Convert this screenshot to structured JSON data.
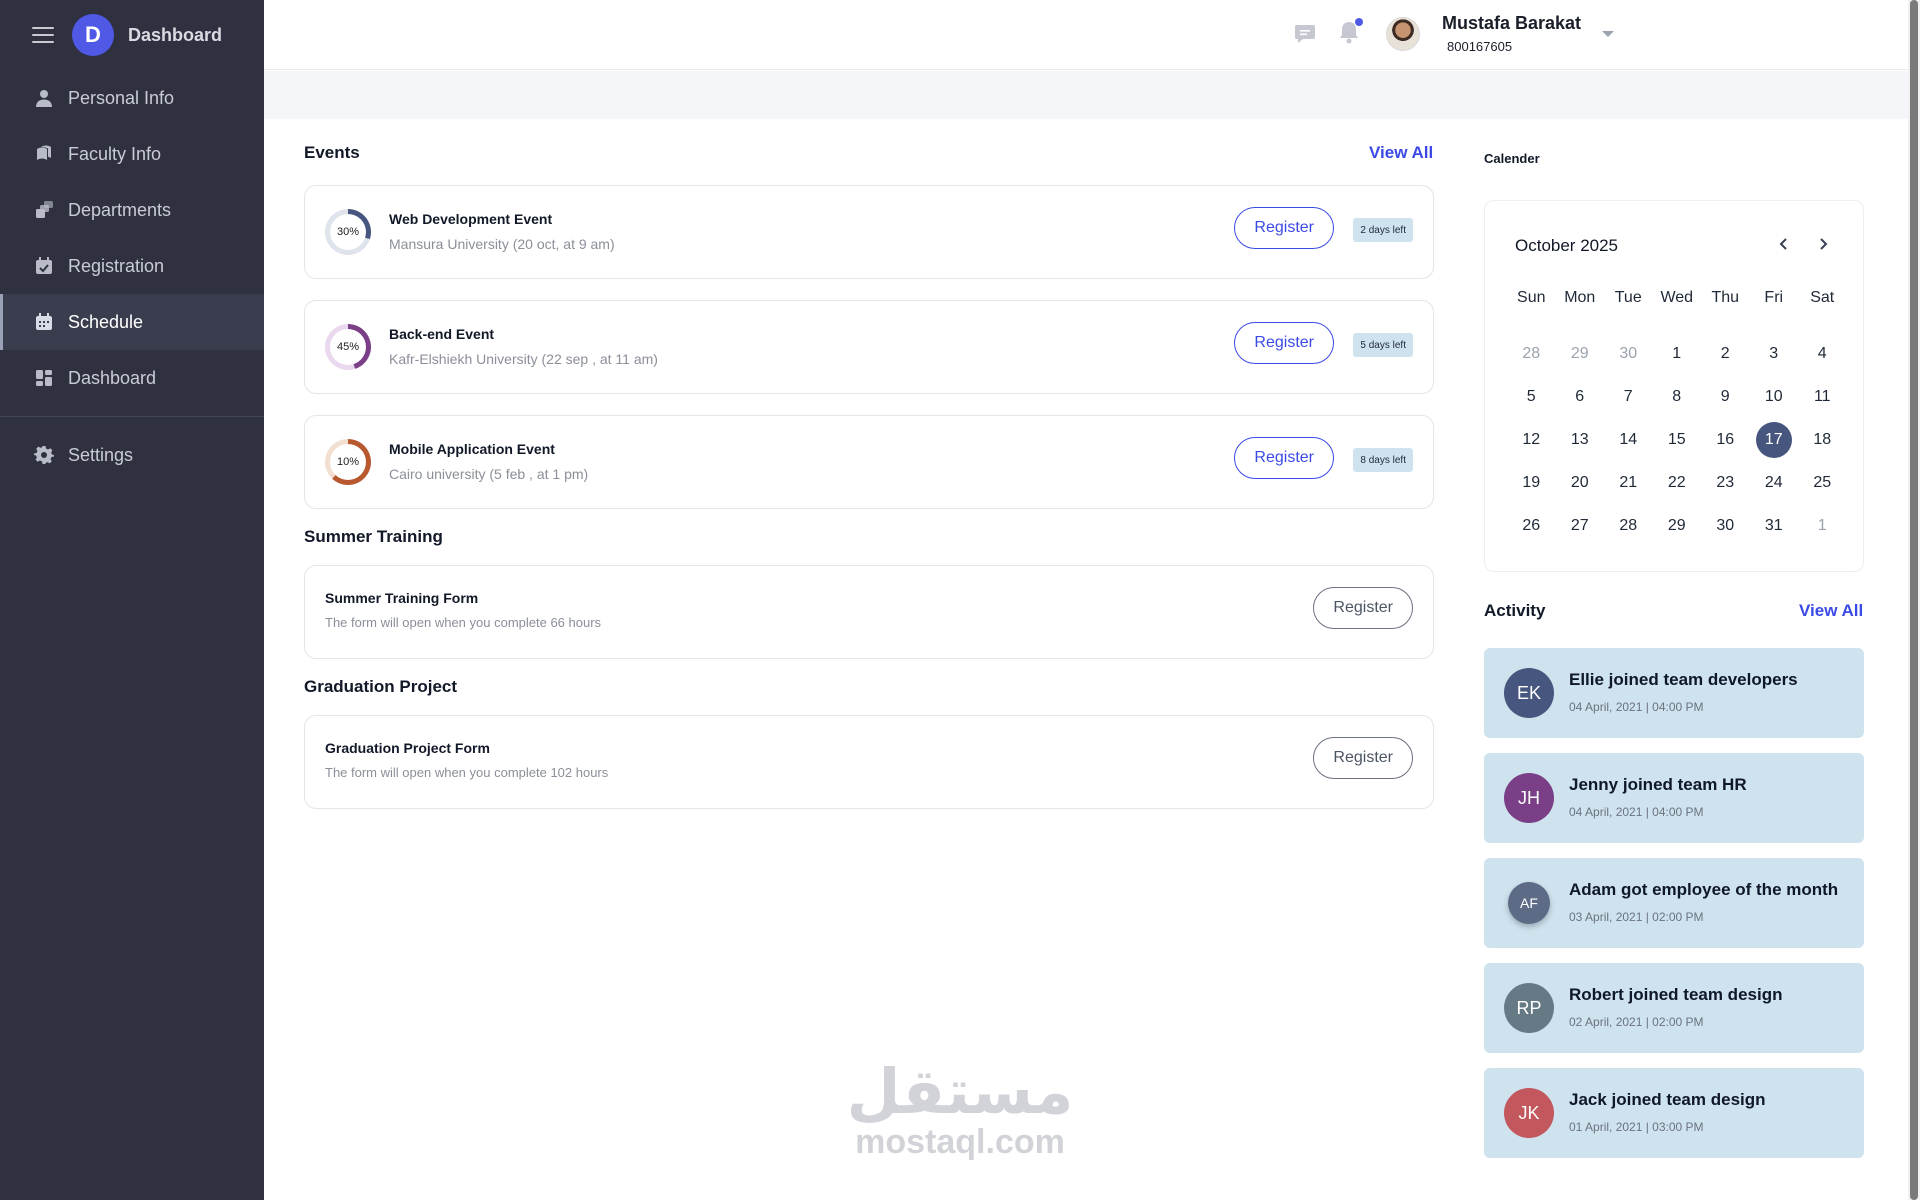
{
  "sidebar": {
    "brand": "Dashboard",
    "logo_letter": "D",
    "items": [
      {
        "label": "Personal Info",
        "icon": "person-icon"
      },
      {
        "label": "Faculty Info",
        "icon": "faculty-icon"
      },
      {
        "label": "Departments",
        "icon": "departments-icon"
      },
      {
        "label": "Registration",
        "icon": "registration-icon"
      },
      {
        "label": "Schedule",
        "icon": "calendar-icon",
        "active": true
      },
      {
        "label": "Dashboard",
        "icon": "dashboard-icon"
      }
    ],
    "settings_label": "Settings"
  },
  "header": {
    "user_name": "Mustafa Barakat",
    "user_id": "800167605"
  },
  "events": {
    "title": "Events",
    "view_all": "View All",
    "items": [
      {
        "title": "Web Development Event",
        "sub": "Mansura University (20 oct, at 9 am)",
        "progress": "30%",
        "button": "Register",
        "days_left": "2 days left",
        "color": "#46567e"
      },
      {
        "title": "Back-end Event",
        "sub": "Kafr-Elshiekh University (22 sep , at 11 am)",
        "progress": "45%",
        "button": "Register",
        "days_left": "5 days left",
        "color": "#7a3f86"
      },
      {
        "title": "Mobile Application Event",
        "sub": "Cairo university (5 feb , at 1 pm)",
        "progress": "10%",
        "button": "Register",
        "days_left": "8 days left",
        "color": "#b8582f"
      }
    ]
  },
  "summer": {
    "title": "Summer Training",
    "form_title": "Summer Training Form",
    "form_sub": "The form will open when you complete 66 hours",
    "button": "Register"
  },
  "graduation": {
    "title": "Graduation Project",
    "form_title": "Graduation Project Form",
    "form_sub": "The form will open when you complete 102 hours",
    "button": "Register"
  },
  "calendar": {
    "title": "Calender",
    "month": "October 2025",
    "weekdays": [
      "Sun",
      "Mon",
      "Tue",
      "Wed",
      "Thu",
      "Fri",
      "Sat"
    ],
    "days": [
      "28",
      "29",
      "30",
      "1",
      "2",
      "3",
      "4",
      "5",
      "6",
      "7",
      "8",
      "9",
      "10",
      "11",
      "12",
      "13",
      "14",
      "15",
      "16",
      "17",
      "18",
      "19",
      "20",
      "21",
      "22",
      "23",
      "24",
      "25",
      "26",
      "27",
      "28",
      "29",
      "30",
      "31",
      "1"
    ],
    "today": "17"
  },
  "activity": {
    "title": "Activity",
    "view_all": "View All",
    "items": [
      {
        "initials": "EK",
        "text": "Ellie joined team developers",
        "time": "04 April, 2021 | 04:00 PM",
        "color": "#46567e"
      },
      {
        "initials": "JH",
        "text": "Jenny joined team HR",
        "time": "04 April, 2021 | 04:00 PM",
        "color": "#7a3f86"
      },
      {
        "initials": "AF",
        "text": "Adam got employee of the month",
        "time": "03 April, 2021 | 02:00 PM",
        "color": "#5d6b87"
      },
      {
        "initials": "RP",
        "text": "Robert joined team design",
        "time": "02 April, 2021 | 02:00 PM",
        "color": "#667a85"
      },
      {
        "initials": "JK",
        "text": "Jack joined team design",
        "time": "01 April, 2021 | 03:00 PM",
        "color": "#c3575e"
      }
    ]
  },
  "watermark": {
    "arabic": "مستقل",
    "latin": "mostaql.com"
  }
}
